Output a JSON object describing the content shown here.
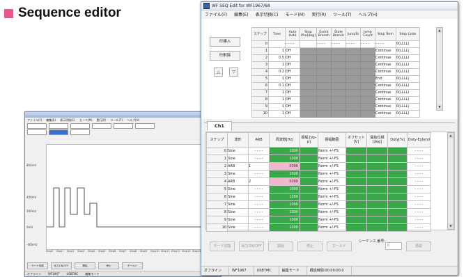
{
  "heading": "Sequence editor",
  "accent_color": "#e8568f",
  "bg_window": {
    "menu": [
      "ファイル(F)",
      "編集(E)",
      "表示切換(C)",
      "モード(M)",
      "実行(R)",
      "ツール(T)",
      "ヘルプ(H)"
    ],
    "y_labels": [
      "800mV",
      "400mV",
      "200mV",
      "0mV",
      "-400mV"
    ],
    "x_labels": [
      "Step0",
      "Step1",
      "Step2",
      "Step3",
      "Step4",
      "Step5",
      "Step6",
      "Step7",
      "Step8",
      "Step9",
      "Step10",
      "Step11",
      "Step12",
      "Step13",
      "Step14",
      "Step15"
    ],
    "status": [
      "オフライン",
      "WF1967",
      "USBTMC",
      "編集モード"
    ]
  },
  "window": {
    "title": "WF SEQ Edit for WF1967/68",
    "menu": [
      "ファイル(F)",
      "編集(E)",
      "表示切換(C)",
      "モード(M)",
      "実行(R)",
      "ツール(T)",
      "ヘルプ(H)"
    ],
    "buttons": {
      "insert": "行挿入",
      "delete": "行削除",
      "up": "△",
      "down": "▽"
    },
    "seq_table": {
      "headers": [
        "ステップ",
        "Time",
        "Auto Hold",
        "Stop Pha[deg]",
        "Event Branch",
        "State Branch",
        "JumpTo",
        "Jump Count",
        "Step Term",
        "Step Code"
      ],
      "rows": [
        [
          "0",
          "",
          "- - - -",
          "",
          "- - - -",
          "- - - -",
          "- - - -",
          "- - - -",
          "- - - -",
          "0(LLLL)"
        ],
        [
          "1",
          "1",
          "Off",
          "",
          "",
          "",
          "",
          "",
          "Continue",
          "0(LLLL)"
        ],
        [
          "2",
          "0.5",
          "Off",
          "",
          "",
          "",
          "",
          "",
          "Continue",
          "0(LLLL)"
        ],
        [
          "3",
          "1",
          "Off",
          "",
          "",
          "",
          "",
          "",
          "Continue",
          "0(LLLL)"
        ],
        [
          "4",
          "0.2",
          "Off",
          "",
          "",
          "",
          "",
          "",
          "Continue",
          "0(LLLL)"
        ],
        [
          "5",
          "1",
          "Off",
          "",
          "",
          "",
          "",
          "",
          "End",
          "0(LLLL)"
        ],
        [
          "6",
          "0.1",
          "Off",
          "",
          "",
          "",
          "",
          "",
          "Continue",
          "0(LLLL)"
        ],
        [
          "7",
          "1",
          "Off",
          "",
          "",
          "",
          "",
          "",
          "Continue",
          "0(LLLL)"
        ],
        [
          "8",
          "1",
          "Off",
          "",
          "",
          "",
          "",
          "",
          "Continue",
          "0(LLLL)"
        ],
        [
          "9",
          "1",
          "Off",
          "",
          "",
          "",
          "",
          "",
          "Continue",
          "0(LLLL)"
        ],
        [
          "10",
          "1",
          "Off",
          "",
          "",
          "",
          "",
          "",
          "Continue",
          "0(LLLL)"
        ]
      ]
    },
    "channel_tab": "Ch1",
    "ch_table": {
      "headers": [
        "ステップ",
        "波形",
        "ARB",
        "周波数[Hz]",
        "振幅 [Vp-p]",
        "振幅範囲",
        "オフセット [V]",
        "開始位相 [deg]",
        "Duty[%]",
        "Duty-Extend"
      ],
      "rows": [
        [
          "0",
          "Sine",
          "- - - -",
          "1000",
          "",
          "Norm +/-FS",
          "",
          "",
          "",
          "- - - -"
        ],
        [
          "1",
          "Sine",
          "- - - -",
          "1000",
          "",
          "Norm +/-FS",
          "",
          "",
          "",
          "- - - -"
        ],
        [
          "2",
          "ARB",
          "1",
          "5000",
          "",
          "Norm +/-FS",
          "",
          "",
          "",
          "- - - -"
        ],
        [
          "3",
          "Sine",
          "- - - -",
          "1000",
          "",
          "Norm +/-FS",
          "",
          "",
          "",
          "- - - -"
        ],
        [
          "4",
          "ARB",
          "2",
          "5000",
          "",
          "Norm +/-FS",
          "",
          "",
          "",
          "- - - -"
        ],
        [
          "5",
          "Sine",
          "- - - -",
          "1000",
          "",
          "Norm +/-FS",
          "",
          "",
          "",
          "- - - -"
        ],
        [
          "6",
          "Sine",
          "- - - -",
          "1000",
          "",
          "Norm +/-FS",
          "",
          "",
          "",
          "- - - -"
        ],
        [
          "7",
          "Sine",
          "- - - -",
          "1000",
          "",
          "Norm +/-FS",
          "",
          "",
          "",
          "- - - -"
        ],
        [
          "8",
          "Sine",
          "- - - -",
          "1000",
          "",
          "Norm +/-FS",
          "",
          "",
          "",
          "- - - -"
        ],
        [
          "9",
          "Sine",
          "- - - -",
          "1000",
          "",
          "Norm +/-FS",
          "",
          "",
          "",
          "- - - -"
        ],
        [
          "10",
          "Sine",
          "- - - -",
          "1000",
          "",
          "Norm +/-FS",
          "",
          "",
          "",
          "- - - -"
        ]
      ]
    },
    "bottom_buttons": [
      "モード切換",
      "出力ON/OFF",
      "開始",
      "停止",
      "ホールド",
      "再開"
    ],
    "sequence_no_label": "シーケンス 番号:",
    "sequence_no_value": "0",
    "status": [
      "オフライン",
      "WF1967",
      "USBTMC",
      "編集モード",
      "経過時間:00:00:00.0"
    ]
  }
}
